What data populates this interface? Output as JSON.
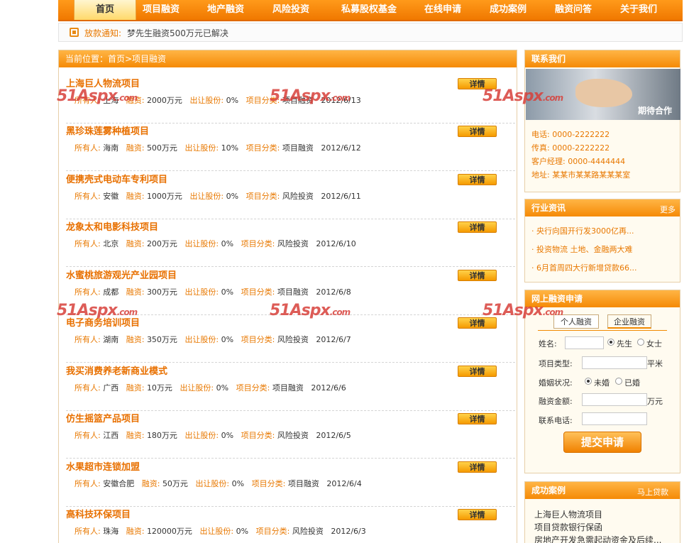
{
  "nav": {
    "items": [
      "首页",
      "项目融资",
      "地产融资",
      "风险投资",
      "私募股权基金",
      "在线申请",
      "成功案例",
      "融资问答",
      "关于我们"
    ]
  },
  "notice": {
    "label": "放款通知:",
    "text": "梦先生融资500万元已解决"
  },
  "main": {
    "location": "当前位置：首页>项目融资",
    "detail_label": "详情",
    "projects": [
      {
        "title": "上海巨人物流项目",
        "owner_label": "所有人:",
        "owner": "上海",
        "fund_label": "融资:",
        "fund": "2000万元",
        "share_label": "出让股份:",
        "share": "0%",
        "cat_label": "项目分类:",
        "cat": "项目融资",
        "date": "2012/6/13"
      },
      {
        "title": "黑珍珠莲雾种植项目",
        "owner_label": "所有人:",
        "owner": "海南",
        "fund_label": "融资:",
        "fund": "500万元",
        "share_label": "出让股份:",
        "share": "10%",
        "cat_label": "项目分类:",
        "cat": "项目融资",
        "date": "2012/6/12"
      },
      {
        "title": "便携壳式电动车专利项目",
        "owner_label": "所有人:",
        "owner": "安徽",
        "fund_label": "融资:",
        "fund": "1000万元",
        "share_label": "出让股份:",
        "share": "0%",
        "cat_label": "项目分类:",
        "cat": "风险投资",
        "date": "2012/6/11"
      },
      {
        "title": "龙象太和电影科技项目",
        "owner_label": "所有人:",
        "owner": "北京",
        "fund_label": "融资:",
        "fund": "200万元",
        "share_label": "出让股份:",
        "share": "0%",
        "cat_label": "项目分类:",
        "cat": "风险投资",
        "date": "2012/6/10"
      },
      {
        "title": "水蜜桃旅游观光产业园项目",
        "owner_label": "所有人:",
        "owner": "成都",
        "fund_label": "融资:",
        "fund": "300万元",
        "share_label": "出让股份:",
        "share": "0%",
        "cat_label": "项目分类:",
        "cat": "项目融资",
        "date": "2012/6/8"
      },
      {
        "title": "电子商务培训项目",
        "owner_label": "所有人:",
        "owner": "湖南",
        "fund_label": "融资:",
        "fund": "350万元",
        "share_label": "出让股份:",
        "share": "0%",
        "cat_label": "项目分类:",
        "cat": "风险投资",
        "date": "2012/6/7"
      },
      {
        "title": "我买消费养老新商业模式",
        "owner_label": "所有人:",
        "owner": "广西",
        "fund_label": "融资:",
        "fund": "10万元",
        "share_label": "出让股份:",
        "share": "0%",
        "cat_label": "项目分类:",
        "cat": "项目融资",
        "date": "2012/6/6"
      },
      {
        "title": "仿生摇篮产品项目",
        "owner_label": "所有人:",
        "owner": "江西",
        "fund_label": "融资:",
        "fund": "180万元",
        "share_label": "出让股份:",
        "share": "0%",
        "cat_label": "项目分类:",
        "cat": "风险投资",
        "date": "2012/6/5"
      },
      {
        "title": "水果超市连锁加盟",
        "owner_label": "所有人:",
        "owner": "安徽合肥",
        "fund_label": "融资:",
        "fund": "50万元",
        "share_label": "出让股份:",
        "share": "0%",
        "cat_label": "项目分类:",
        "cat": "项目融资",
        "date": "2012/6/4"
      },
      {
        "title": "高科技环保项目",
        "owner_label": "所有人:",
        "owner": "珠海",
        "fund_label": "融资:",
        "fund": "120000万元",
        "share_label": "出让股份:",
        "share": "0%",
        "cat_label": "项目分类:",
        "cat": "风险投资",
        "date": "2012/6/3"
      }
    ]
  },
  "contact": {
    "title": "联系我们",
    "image_caption": "期待合作",
    "phone": "电话: 0000-2222222",
    "fax": "传真: 0000-2222222",
    "manager": "客户经理: 0000-4444444",
    "address": "地址: 某某市某某路某某某室"
  },
  "news": {
    "title": "行业资讯",
    "more": "更多",
    "items": [
      "· 央行向国开行发3000亿再...",
      "· 投资物流 土地、金融两大难",
      "· 6月首周四大行新增贷款66..."
    ]
  },
  "apply": {
    "title": "网上融资申请",
    "tabs": [
      "个人融资",
      "企业融资"
    ],
    "name_label": "姓名:",
    "male": "先生",
    "female": "女士",
    "type_label": "项目类型:",
    "type_unit": "平米",
    "marital_label": "婚姻状况:",
    "unmarried": "未婚",
    "married": "已婚",
    "amount_label": "融资金额:",
    "amount_unit": "万元",
    "phone_label": "联系电话:",
    "submit": "提交申请"
  },
  "cases": {
    "title": "成功案例",
    "more": "马上贷款",
    "items": [
      "上海巨人物流项目",
      "项目贷款银行保函",
      "房地产开发急需起动资金及后续..."
    ]
  },
  "watermark": {
    "text": "51Aspx",
    "suffix": ".com"
  }
}
